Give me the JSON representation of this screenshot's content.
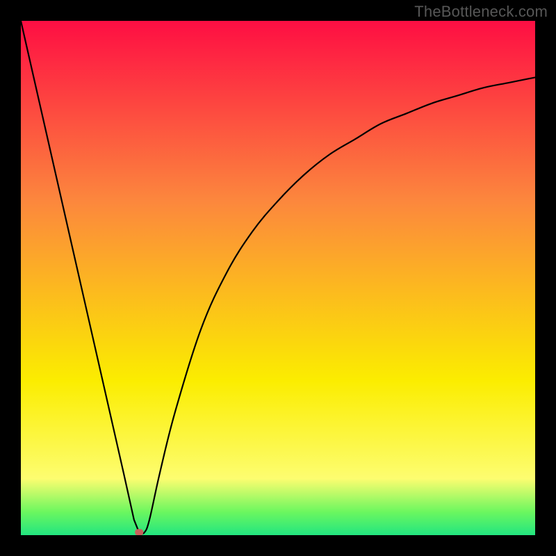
{
  "watermark": "TheBottleneck.com",
  "colors": {
    "top": "#fe0e43",
    "orange": "#fc873d",
    "yellow": "#fbed00",
    "pale_yellow": "#fdfd70",
    "lime": "#6bf75f",
    "green": "#22e580",
    "black": "#000000",
    "marker": "#c9605c"
  },
  "chart_data": {
    "type": "line",
    "title": "",
    "xlabel": "",
    "ylabel": "",
    "xlim": [
      0,
      100
    ],
    "ylim": [
      0,
      100
    ],
    "grid": false,
    "legend": false,
    "annotations": [],
    "series": [
      {
        "name": "curve",
        "x": [
          0,
          5,
          10,
          15,
          20,
          22,
          23,
          24,
          25,
          27,
          30,
          35,
          40,
          45,
          50,
          55,
          60,
          65,
          70,
          75,
          80,
          85,
          90,
          95,
          100
        ],
        "y": [
          100,
          78,
          56,
          34,
          12,
          3,
          0.5,
          0.5,
          3,
          12,
          24,
          40,
          51,
          59,
          65,
          70,
          74,
          77,
          80,
          82,
          84,
          85.5,
          87,
          88,
          89
        ]
      }
    ],
    "marker": {
      "x": 23,
      "y": 0.5
    },
    "description": "Bottleneck-style V curve with vertical rainbow gradient (red at top through orange/yellow to green at bottom). Minimum near x≈23. Small rounded marker at the minimum."
  }
}
